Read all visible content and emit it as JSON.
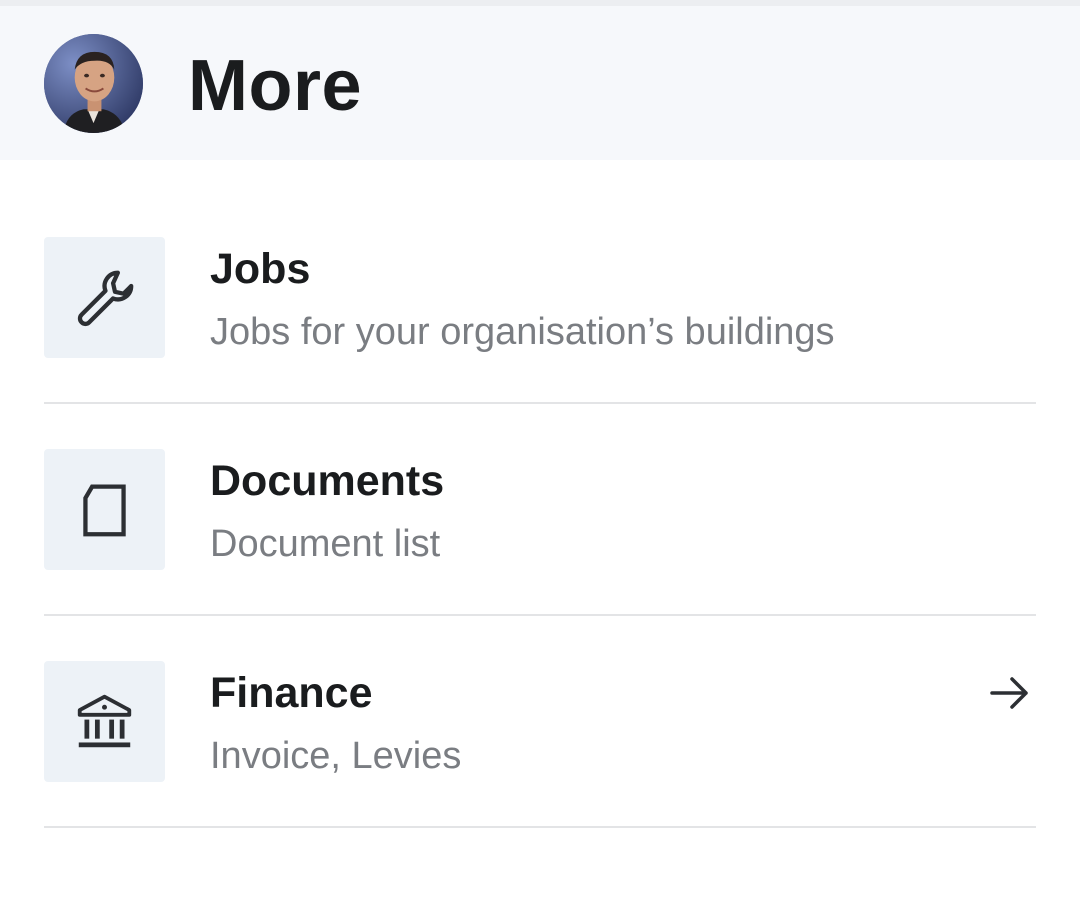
{
  "header": {
    "title": "More",
    "avatar_icon": "user-avatar-photo"
  },
  "menu": {
    "items": [
      {
        "title": "Jobs",
        "subtitle": "Jobs for your organisation’s buildings",
        "icon": "wrench-icon",
        "has_arrow": false
      },
      {
        "title": "Documents",
        "subtitle": "Document list",
        "icon": "document-icon",
        "has_arrow": false
      },
      {
        "title": "Finance",
        "subtitle": "Invoice, Levies",
        "icon": "bank-icon",
        "has_arrow": true
      }
    ]
  },
  "colors": {
    "header_bg": "#f6f8fb",
    "icon_box_bg": "#edf2f7",
    "text_primary": "#1a1c1e",
    "text_secondary": "#7a7d82",
    "divider": "#e3e4e6"
  }
}
